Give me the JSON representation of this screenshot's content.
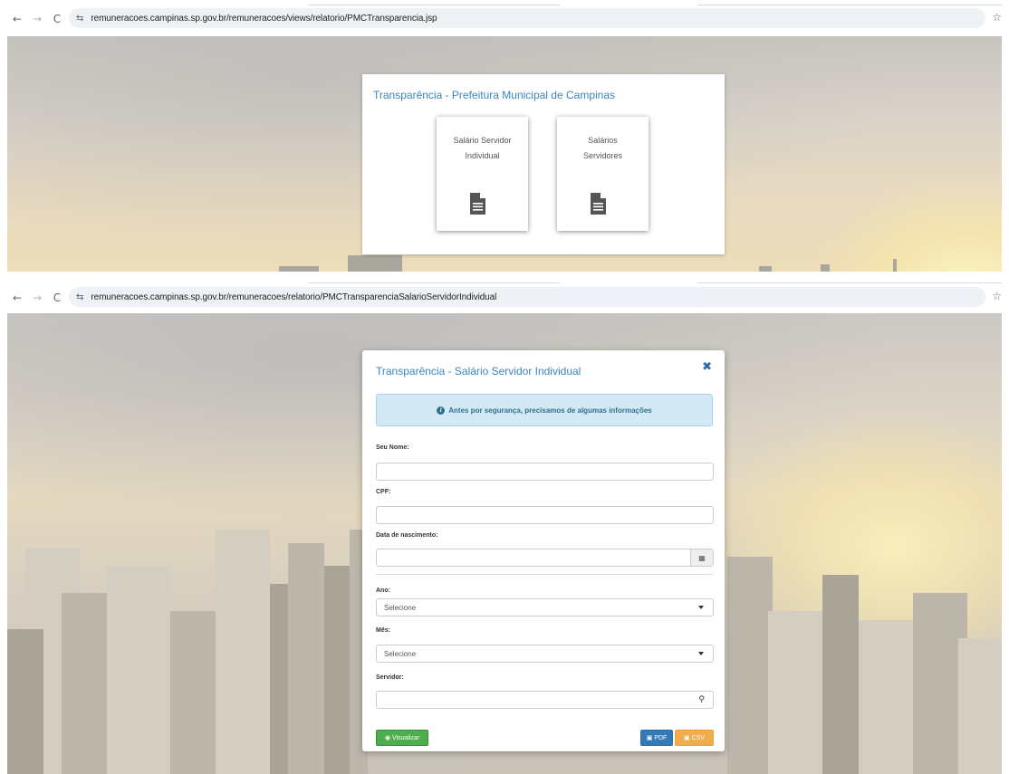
{
  "screen1": {
    "url": "remuneracoes.campinas.sp.gov.br/remuneracoes/views/relatorio/PMCTransparencia.jsp",
    "card_title": "Transparência - Prefeitura Municipal de Campinas",
    "tiles": [
      {
        "line1": "Salário Servidor",
        "line2": "Individual"
      },
      {
        "line1": "Salários",
        "line2": "Servidores"
      }
    ]
  },
  "screen2": {
    "url": "remuneracoes.campinas.sp.gov.br/remuneracoes/relatorio/PMCTransparenciaSalarioServidorIndividual",
    "modal_title": "Transparência - Salário Servidor Individual",
    "close_glyph": "✖",
    "alert_text": "Antes por segurança, precisamos de algumas informações",
    "fields": {
      "nome_label": "Seu Nome:",
      "cpf_label": "CPF:",
      "nascimento_label": "Data de nascimento:",
      "ano_label": "Ano:",
      "ano_value": "Selecione",
      "mes_label": "Mês:",
      "mes_value": "Selecione",
      "servidor_label": "Servidor:"
    },
    "buttons": {
      "visualizar": "Visualizar",
      "pdf": "PDF",
      "csv": "CSV"
    }
  },
  "browser": {
    "back": "←",
    "forward": "→",
    "reload": "C",
    "tune": "⇆",
    "star": "☆"
  },
  "colors": {
    "link_blue": "#3a86c1",
    "success": "#4cae4c",
    "primary": "#337ab7",
    "warning": "#f0ad4e",
    "info_bg": "#d3e9f5"
  }
}
